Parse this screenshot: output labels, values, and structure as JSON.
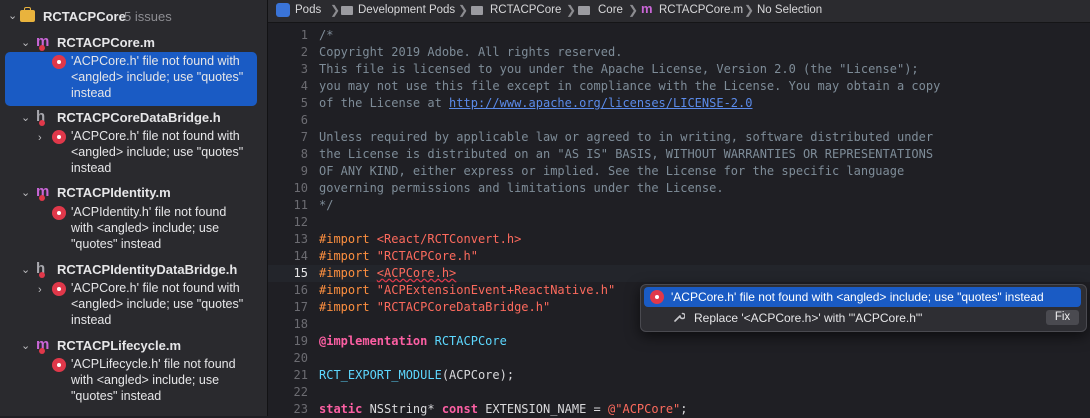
{
  "navigator": {
    "project": {
      "name": "RCTACPCore",
      "count": "5 issues"
    },
    "groups": [
      {
        "file": "RCTACPCore.m",
        "kind": "m",
        "issues": [
          {
            "text": "'ACPCore.h' file not found with <angled> include; use \"quotes\" instead"
          }
        ]
      },
      {
        "file": "RCTACPCoreDataBridge.h",
        "kind": "h",
        "issues": [
          {
            "text": "'ACPCore.h' file not found with <angled> include; use \"quotes\" instead"
          }
        ]
      },
      {
        "file": "RCTACPIdentity.m",
        "kind": "m",
        "issues": [
          {
            "text": "'ACPIdentity.h' file not found with <angled> include; use \"quotes\" instead"
          }
        ]
      },
      {
        "file": "RCTACPIdentityDataBridge.h",
        "kind": "h",
        "issues": [
          {
            "text": "'ACPCore.h' file not found with <angled> include; use \"quotes\" instead"
          }
        ]
      },
      {
        "file": "RCTACPLifecycle.m",
        "kind": "m",
        "issues": [
          {
            "text": "'ACPLifecycle.h' file not found with <angled> include; use \"quotes\" instead"
          }
        ]
      }
    ],
    "file_glyphs": {
      "m": "m",
      "h": "h"
    }
  },
  "jumpbar": {
    "crumbs": [
      "Pods",
      "Development Pods",
      "RCTACPCore",
      "Core",
      "RCTACPCore.m",
      "No Selection"
    ],
    "separator": "❯"
  },
  "editor": {
    "current_line": 15,
    "lines": [
      {
        "n": "1",
        "parts": [
          {
            "t": "/*",
            "c": "comment"
          }
        ]
      },
      {
        "n": "2",
        "parts": [
          {
            "t": "Copyright 2019 Adobe. All rights reserved.",
            "c": "comment"
          }
        ]
      },
      {
        "n": "3",
        "parts": [
          {
            "t": "This file is licensed to you under the Apache License, Version 2.0 (the \"License\");",
            "c": "comment"
          }
        ]
      },
      {
        "n": "4",
        "parts": [
          {
            "t": "you may not use this file except in compliance with the License. You may obtain a copy",
            "c": "comment"
          }
        ]
      },
      {
        "n": "5",
        "parts": [
          {
            "t": "of the License at ",
            "c": "comment"
          },
          {
            "t": "http://www.apache.org/licenses/LICENSE-2.0",
            "c": "url"
          }
        ]
      },
      {
        "n": "6",
        "parts": []
      },
      {
        "n": "7",
        "parts": [
          {
            "t": "Unless required by applicable law or agreed to in writing, software distributed under",
            "c": "comment"
          }
        ]
      },
      {
        "n": "8",
        "parts": [
          {
            "t": "the License is distributed on an \"AS IS\" BASIS, WITHOUT WARRANTIES OR REPRESENTATIONS",
            "c": "comment"
          }
        ]
      },
      {
        "n": "9",
        "parts": [
          {
            "t": "OF ANY KIND, either express or implied. See the License for the specific language",
            "c": "comment"
          }
        ]
      },
      {
        "n": "10",
        "parts": [
          {
            "t": "governing permissions and limitations under the License.",
            "c": "comment"
          }
        ]
      },
      {
        "n": "11",
        "parts": [
          {
            "t": "*/",
            "c": "comment"
          }
        ]
      },
      {
        "n": "12",
        "parts": []
      },
      {
        "n": "13",
        "parts": [
          {
            "t": "#import ",
            "c": "pp"
          },
          {
            "t": "<React/RCTConvert.h>",
            "c": "str"
          }
        ]
      },
      {
        "n": "14",
        "parts": [
          {
            "t": "#import ",
            "c": "pp"
          },
          {
            "t": "\"RCTACPCore.h\"",
            "c": "str"
          }
        ]
      },
      {
        "n": "15",
        "parts": [
          {
            "t": "#import ",
            "c": "pp"
          },
          {
            "t": "<ACPCore.h>",
            "c": "str errline"
          }
        ]
      },
      {
        "n": "16",
        "parts": [
          {
            "t": "#import ",
            "c": "pp"
          },
          {
            "t": "\"ACPExtensionEvent+ReactNative.h\"",
            "c": "str"
          }
        ]
      },
      {
        "n": "17",
        "parts": [
          {
            "t": "#import ",
            "c": "pp"
          },
          {
            "t": "\"RCTACPCoreDataBridge.h\"",
            "c": "str"
          }
        ]
      },
      {
        "n": "18",
        "parts": []
      },
      {
        "n": "19",
        "parts": [
          {
            "t": "@implementation ",
            "c": "kw"
          },
          {
            "t": "RCTACPCore",
            "c": "cls"
          }
        ]
      },
      {
        "n": "20",
        "parts": []
      },
      {
        "n": "21",
        "parts": [
          {
            "t": "RCT_EXPORT_MODULE",
            "c": "cls"
          },
          {
            "t": "(ACPCore);",
            "c": ""
          }
        ]
      },
      {
        "n": "22",
        "parts": []
      },
      {
        "n": "23",
        "parts": [
          {
            "t": "static ",
            "c": "kw"
          },
          {
            "t": "NSString* ",
            "c": ""
          },
          {
            "t": "const ",
            "c": "kw"
          },
          {
            "t": "EXTENSION_NAME = ",
            "c": ""
          },
          {
            "t": "@\"ACPCore\"",
            "c": "str"
          },
          {
            "t": ";",
            "c": ""
          }
        ]
      }
    ]
  },
  "popover": {
    "error": "'ACPCore.h' file not found with <angled> include; use \"quotes\" instead",
    "fix": "Replace '<ACPCore.h>' with '\"ACPCore.h\"'",
    "fix_button": "Fix"
  },
  "colors": {
    "accent": "#1a5bc4",
    "error": "#e0384a",
    "m_file": "#c966d6"
  },
  "icons": {
    "project": "briefcase-icon",
    "m_file": "objc-m-file-icon",
    "h_file": "header-file-icon",
    "error": "error-icon",
    "fix": "wrench-icon",
    "disclosure": "chevron-icon"
  }
}
